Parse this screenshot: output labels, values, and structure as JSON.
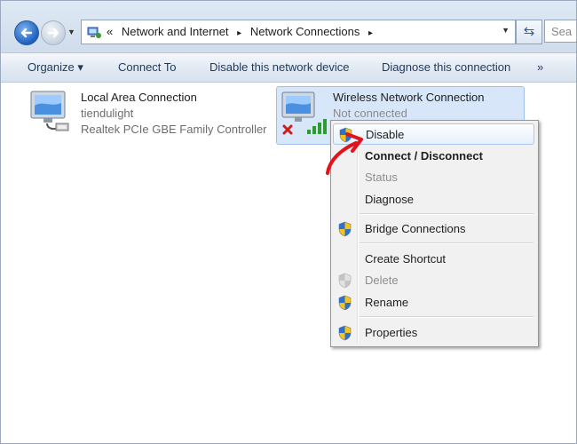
{
  "address": {
    "overflow": "«",
    "crumbs": [
      "Network and Internet",
      "Network Connections"
    ],
    "separator": "▸",
    "search_placeholder": "Sea"
  },
  "toolbar": {
    "organize": "Organize ▾",
    "connect_to": "Connect To",
    "disable": "Disable this network device",
    "diagnose": "Diagnose this connection",
    "more": "»"
  },
  "connections": [
    {
      "name": "Local Area Connection",
      "line2": "tiendulight",
      "line3": "Realtek PCIe GBE Family Controller"
    },
    {
      "name": "Wireless Network Connection",
      "line2": "Not connected"
    }
  ],
  "menu": {
    "items": [
      {
        "label": "Disable",
        "shield": true,
        "style": "highlight"
      },
      {
        "label": "Connect / Disconnect",
        "style": "bold"
      },
      {
        "label": "Status",
        "style": "disabled"
      },
      {
        "label": "Diagnose",
        "style": "normal"
      },
      {
        "label": "Bridge Connections",
        "shield": true,
        "style": "normal"
      },
      {
        "label": "Create Shortcut",
        "style": "normal"
      },
      {
        "label": "Delete",
        "shield": true,
        "style": "disabled"
      },
      {
        "label": "Rename",
        "shield": true,
        "style": "normal"
      },
      {
        "label": "Properties",
        "shield": true,
        "style": "normal"
      }
    ]
  },
  "colors": {
    "annotation_arrow": "#e3131b",
    "toolbar_text": "#1e395b",
    "selection": "#d7e6f8"
  }
}
